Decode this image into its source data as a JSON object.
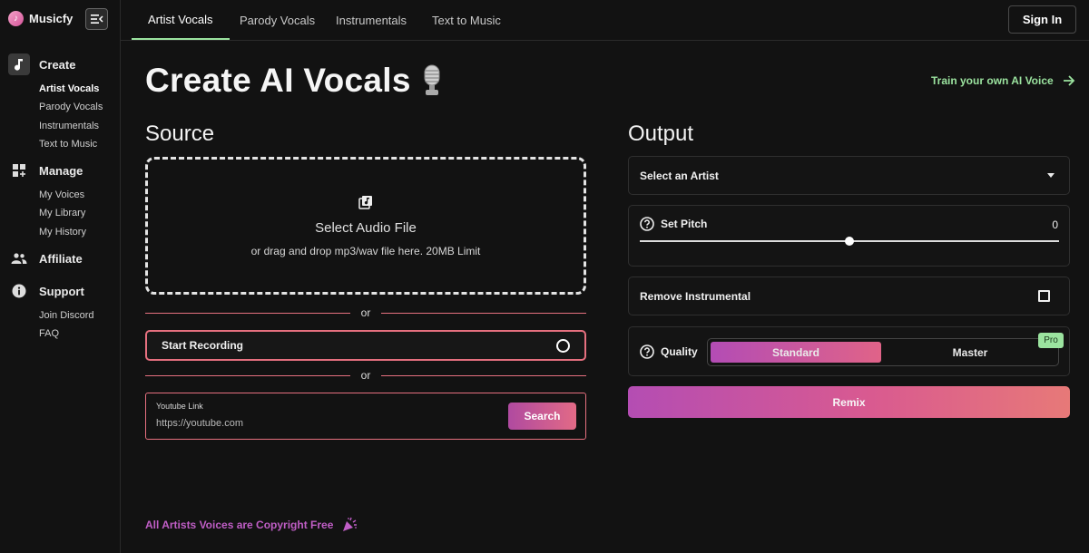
{
  "brand": {
    "name": "Musicfy"
  },
  "sidebar": {
    "sections": [
      {
        "label": "Create",
        "icon": "music-note-icon",
        "items": [
          "Artist Vocals",
          "Parody Vocals",
          "Instrumentals",
          "Text to Music"
        ]
      },
      {
        "label": "Manage",
        "icon": "dashboard-add-icon",
        "items": [
          "My Voices",
          "My Library",
          "My History"
        ]
      },
      {
        "label": "Affiliate",
        "icon": "people-icon",
        "items": []
      },
      {
        "label": "Support",
        "icon": "info-icon",
        "items": [
          "Join Discord",
          "FAQ"
        ]
      }
    ],
    "active_item": "Artist Vocals"
  },
  "topbar": {
    "tabs": [
      "Artist Vocals",
      "Parody Vocals",
      "Instrumentals",
      "Text to Music"
    ],
    "active_tab": "Artist Vocals",
    "signin_label": "Sign In"
  },
  "main": {
    "title": "Create AI Vocals",
    "title_icon": "microphone-emoji",
    "train_link": "Train your own AI Voice",
    "source": {
      "title": "Source",
      "dropzone_title": "Select Audio File",
      "dropzone_hint": "or drag and drop mp3/wav file here. 20MB Limit",
      "or_label": "or",
      "recording_label": "Start Recording",
      "youtube_label": "Youtube Link",
      "youtube_placeholder": "https://youtube.com",
      "search_label": "Search"
    },
    "output": {
      "title": "Output",
      "artist_select": "Select an Artist",
      "pitch_label": "Set Pitch",
      "pitch_value": "0",
      "pitch_level": 0.5,
      "remove_instrumental_label": "Remove Instrumental",
      "remove_instrumental_checked": false,
      "quality_label": "Quality",
      "quality_options": [
        "Standard",
        "Master"
      ],
      "quality_selected": "Standard",
      "pro_badge": "Pro",
      "remix_label": "Remix"
    },
    "footer_note": "All Artists Voices are Copyright Free"
  },
  "colors": {
    "accent_green": "#9be39f",
    "accent_pink": "#e6707f",
    "gradient_start": "#b44db3",
    "gradient_end": "#e77978",
    "background": "#121212"
  }
}
